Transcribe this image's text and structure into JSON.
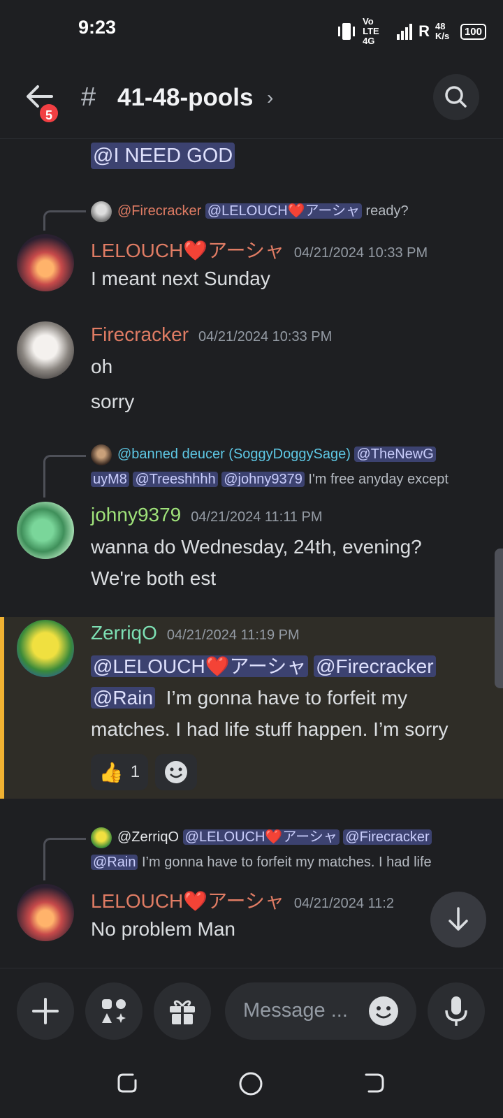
{
  "status_bar": {
    "time": "9:23",
    "network": "Vo LTE 4G",
    "carrier": "R",
    "speed": "48 K/s",
    "battery": "100"
  },
  "header": {
    "channel_name": "41-48-pools",
    "unread_badge": "5"
  },
  "messages": {
    "top_mention": "@I NEED GOD",
    "m1": {
      "reply_author": "@Firecracker",
      "reply_mention": "@LELOUCH❤️アーシャ",
      "reply_text": "ready?",
      "author": "LELOUCH❤️アーシャ",
      "timestamp": "04/21/2024 10:33 PM",
      "text": "I meant next Sunday"
    },
    "m2": {
      "author": "Firecracker",
      "timestamp": "04/21/2024 10:33 PM",
      "line1": "oh",
      "line2": "sorry"
    },
    "m3": {
      "reply_author": "@banned deucer (SoggyDoggySage)",
      "reply_mention1a": "@TheNewG",
      "reply_mention1b": "uyM8",
      "reply_mention2": "@Treeshhhh",
      "reply_mention3": "@johny9379",
      "reply_text": "I'm free anyday except",
      "author": "johny9379",
      "timestamp": "04/21/2024 11:11 PM",
      "line1": "wanna do Wednesday, 24th, evening?",
      "line2": "We're both est"
    },
    "m4": {
      "author": "ZerriqO",
      "timestamp": "04/21/2024 11:19 PM",
      "mention1": "@LELOUCH❤️アーシャ",
      "mention2": "@Firecracker",
      "mention3": "@Rain",
      "text1": "I’m gonna have to forfeit my",
      "text2": "matches. I had life stuff happen. I’m sorry",
      "reaction_count": "1"
    },
    "m5": {
      "reply_author": "@ZerriqO",
      "reply_mention1": "@LELOUCH❤️アーシャ",
      "reply_mention2": "@Firecracker",
      "reply_mention3": "@Rain",
      "reply_text": "I’m gonna have to forfeit my matches. I had life",
      "author": "LELOUCH❤️アーシャ",
      "timestamp": "04/21/2024 11:2",
      "text": "No problem Man"
    }
  },
  "composer": {
    "placeholder": "Message ..."
  },
  "colors": {
    "lelouch": "#e07c64",
    "firecracker": "#e07c64",
    "johny": "#9fe27a",
    "zerriq": "#7de0b4",
    "banned": "#5ec8e5",
    "mention_bg": "#3c4270"
  }
}
